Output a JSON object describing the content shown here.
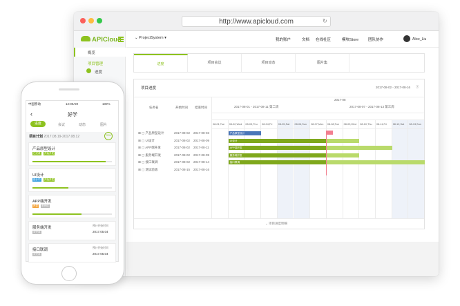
{
  "browser": {
    "url": "http://www.apicloud.com"
  },
  "app": {
    "logo": "APICloud",
    "nav": [
      "概览",
      "项目管理",
      "进度"
    ]
  },
  "topbar": {
    "project": "ProjectSystem",
    "links": [
      "我的账户",
      "文档",
      "在线社区",
      "模块Store",
      "团队协作"
    ],
    "user": "Alice_Liu"
  },
  "tabs": [
    "进度",
    "项目会议",
    "项目动态",
    "图片集"
  ],
  "panel": {
    "title": "项目进度",
    "range": "2017-08-02 - 2017-08-16",
    "col_task": "任务名",
    "col_start": "开始时间",
    "col_end": "结束时间",
    "group_left": "2017-08-01 - 2017-08-11 第二周",
    "group_right": "2017-08-07 - 2017-08-13 第三周",
    "year": "2017-08",
    "footer": "项目进度明细"
  },
  "days": [
    "08-01,Tue",
    "08-02,Wed",
    "08-03,Thu",
    "08-04,Fri",
    "08-05,Sat",
    "08-06,Sun",
    "08-07,Mon",
    "08-08,Tue",
    "08-09,Wed",
    "08-10,Thu",
    "08-11,Fri",
    "08-12,Sat",
    "08-13,Sun"
  ],
  "tasks": [
    {
      "name": "产品原型设计",
      "start": "2017-08-02",
      "end": "2017-08-03"
    },
    {
      "name": "UI设计",
      "start": "2017-08-02",
      "end": "2017-08-09"
    },
    {
      "name": "APP端开发",
      "start": "2017-08-02",
      "end": "2017-08-11"
    },
    {
      "name": "服务端开发",
      "start": "2017-08-02",
      "end": "2017-08-09"
    },
    {
      "name": "接口联调",
      "start": "2017-08-02",
      "end": "2017-08-14"
    },
    {
      "name": "测试验收",
      "start": "2017-08-15",
      "end": "2017-08-16"
    }
  ],
  "bars": [
    "产品原型设计",
    "UI设计",
    "APP端开发",
    "服务端开发",
    "接口联调"
  ],
  "phone": {
    "carrier": "中国移动",
    "time": "12:00AM",
    "battery": "100%",
    "title": "好学",
    "tabs": [
      "进度",
      "会议",
      "动态",
      "图片"
    ],
    "plan_label": "项目计划",
    "plan_range": "2017.08.19-2017.08.12",
    "progress_badge": "76%",
    "cards": [
      {
        "title": "产品原型设计",
        "tags": [
          "已完成",
          "开始开发"
        ]
      },
      {
        "title": "UI设计",
        "tags": [
          "设计中",
          "开始开发"
        ]
      },
      {
        "title": "APP端开发",
        "tags": [
          "开发",
          "未完成"
        ]
      },
      {
        "title": "服务端开发",
        "tags": [
          "未完成"
        ],
        "note": "预计开始时间",
        "date": "2017.05.04"
      },
      {
        "title": "接口联调",
        "tags": [
          "未完成"
        ],
        "note": "预计开始时间",
        "date": "2017.05.04"
      }
    ]
  },
  "colors": {
    "accent": "#8dc21f",
    "bar_dark": "#7fa81c",
    "bar_light": "#b9da6b",
    "today": "#f27f8f",
    "blue": "#4a76b8"
  }
}
